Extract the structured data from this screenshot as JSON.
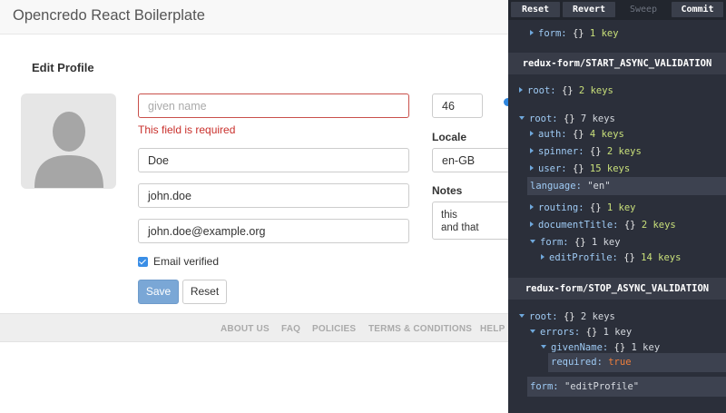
{
  "app": {
    "brand": "Opencredo React Boilerplate",
    "heading": "Edit Profile",
    "form": {
      "given_name_placeholder": "given name",
      "given_name_error": "This field is required",
      "family_name": "Doe",
      "username": "john.doe",
      "email": "john.doe@example.org",
      "email_verified_label": "Email verified",
      "email_verified_checked": true,
      "age": "46",
      "locale_label": "Locale",
      "locale_value": "en-GB",
      "notes_label": "Notes",
      "notes_lines": [
        "this",
        "and that"
      ],
      "save_label": "Save",
      "reset_label": "Reset"
    },
    "footer_links": [
      "ABOUT US",
      "FAQ",
      "POLICIES",
      "TERMS & CONDITIONS",
      "HELP"
    ]
  },
  "devtools": {
    "toolbar": {
      "reset": "Reset",
      "revert": "Revert",
      "sweep": "Sweep",
      "commit": "Commit"
    },
    "top_form_row": {
      "key": "form:",
      "type": "{}",
      "count": "1 key"
    },
    "action_start": "redux-form/START_ASYNC_VALIDATION",
    "action_stop": "redux-form/STOP_ASYNC_VALIDATION",
    "start_tree": {
      "root_collapsed": {
        "key": "root:",
        "type": "{}",
        "count": "2 keys"
      },
      "root_expanded": {
        "key": "root:",
        "type": "{}",
        "count": "7 keys"
      },
      "auth": {
        "key": "auth:",
        "type": "{}",
        "count": "4 keys"
      },
      "spinner": {
        "key": "spinner:",
        "type": "{}",
        "count": "2 keys"
      },
      "user": {
        "key": "user:",
        "type": "{}",
        "count": "15 keys"
      },
      "language": {
        "key": "language:",
        "value": "\"en\""
      },
      "routing": {
        "key": "routing:",
        "type": "{}",
        "count": "1 key"
      },
      "documentTitle": {
        "key": "documentTitle:",
        "type": "{}",
        "count": "2 keys"
      },
      "form": {
        "key": "form:",
        "type": "{}",
        "count": "1 key"
      },
      "editProfile": {
        "key": "editProfile:",
        "type": "{}",
        "count": "14 keys"
      }
    },
    "stop_tree": {
      "root": {
        "key": "root:",
        "type": "{}",
        "count": "2 keys"
      },
      "errors": {
        "key": "errors:",
        "type": "{}",
        "count": "1 key"
      },
      "givenName": {
        "key": "givenName:",
        "type": "{}",
        "count": "1 key"
      },
      "required": {
        "key": "required:",
        "value": "true"
      },
      "form": {
        "key": "form:",
        "value": "\"editProfile\""
      }
    }
  }
}
